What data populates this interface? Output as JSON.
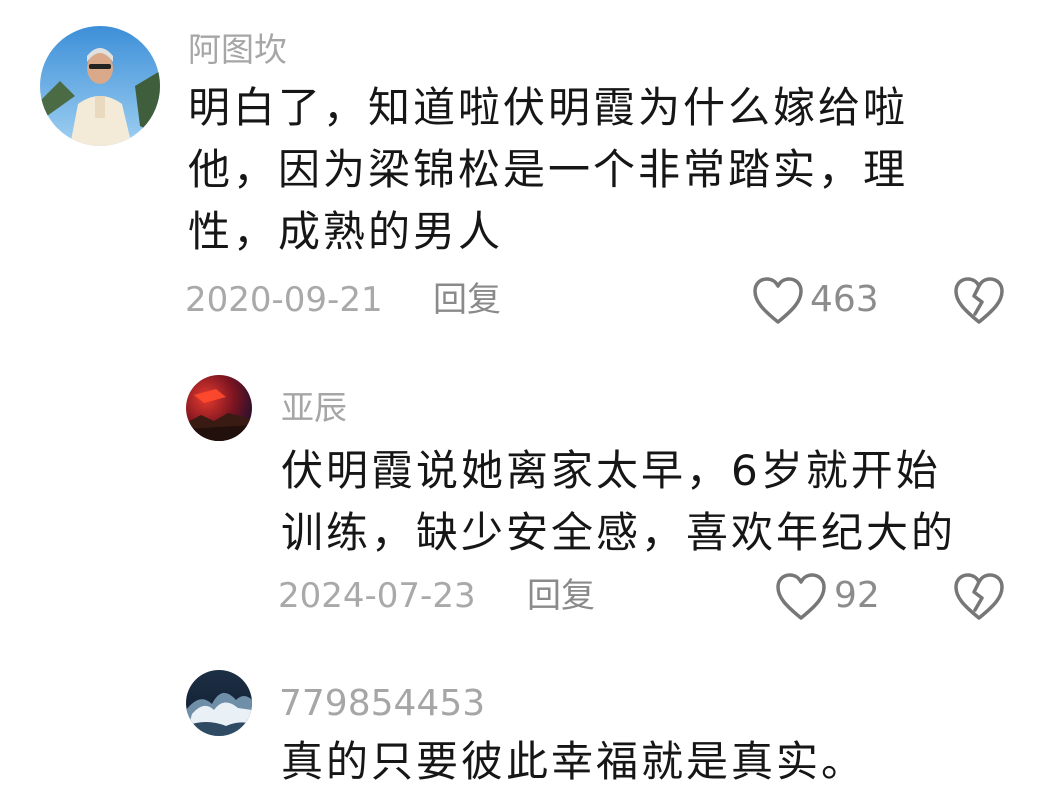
{
  "comments": [
    {
      "username": "阿图坎",
      "text_lines": [
        "明白了，知道啦伏明霞为什么嫁给啦",
        "他，因为梁锦松是一个非常踏实，理",
        "性，成熟的男人"
      ],
      "date": "2020-09-21",
      "reply_label": "回复",
      "likes": "463"
    },
    {
      "username": "亚辰",
      "text_lines": [
        "伏明霞说她离家太早，6岁就开始",
        "训练，缺少安全感，喜欢年纪大的"
      ],
      "date": "2024-07-23",
      "reply_label": "回复",
      "likes": "92"
    },
    {
      "username": "779854453",
      "text_lines": [
        "真的只要彼此幸福就是真实。"
      ]
    }
  ],
  "icons": {
    "like": "heart-outline-icon",
    "dislike": "broken-heart-icon"
  },
  "colors": {
    "username": "#a6a6a6",
    "text": "#161616",
    "meta": "#a9a9a9"
  }
}
